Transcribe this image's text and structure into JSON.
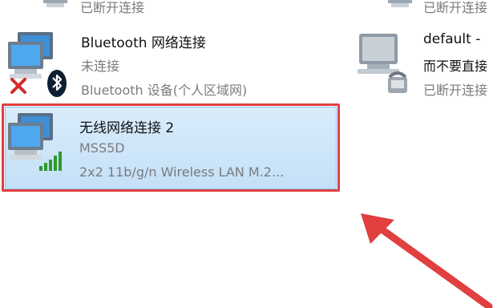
{
  "top_left_status": "已断开连接",
  "top_right_status": "已断开连接",
  "bluetooth": {
    "name": "Bluetooth 网络连接",
    "status": "未连接",
    "device": "Bluetooth 设备(个人区域网)"
  },
  "default_conn": {
    "name": "default - ",
    "status": "而不要直接",
    "state": "已断开连接"
  },
  "wireless": {
    "name": "无线网络连接 2",
    "ssid": "MSS5D",
    "device": "2x2 11b/g/n Wireless LAN M.2..."
  },
  "colors": {
    "highlight": "#e0403f",
    "selection": "#cce4f7",
    "arrow": "#e0403f",
    "signal": "#2e9a2e"
  },
  "icons": {
    "computer": "network-computer-icon",
    "bluetooth": "bluetooth-icon",
    "disconnect": "red-x-icon",
    "signal": "signal-bars-icon",
    "dialup": "dialup-phone-icon"
  }
}
